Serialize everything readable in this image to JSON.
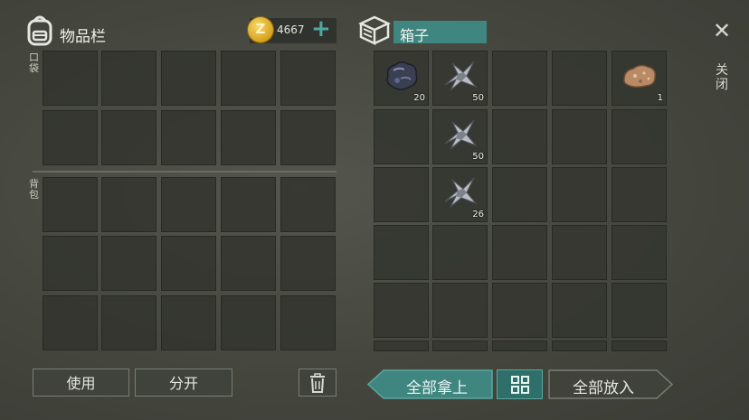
{
  "inventory": {
    "title": "物品栏",
    "icon": "backpack-icon"
  },
  "currency": {
    "amount": "4667",
    "coin_icon": "coin-icon",
    "coin_symbol": "Z",
    "add_symbol": "+"
  },
  "pockets": {
    "label": "口袋"
  },
  "backpack": {
    "label": "背包"
  },
  "container": {
    "title": "箱子",
    "icon": "box-icon"
  },
  "close": {
    "symbol": "✕",
    "label": "关闭"
  },
  "container_items": [
    {
      "name": "coal-ore",
      "count": "20"
    },
    {
      "name": "metal-shard",
      "count": "50"
    },
    {
      "name": "copper-ore",
      "count": "1"
    },
    {
      "name": "metal-shard",
      "count": "50"
    },
    {
      "name": "metal-shard",
      "count": "26"
    }
  ],
  "buttons": {
    "use": "使用",
    "split": "分开",
    "trash_icon": "trash-icon",
    "take_all": "全部拿上",
    "grid_icon": "grid-icon",
    "put_all": "全部放入"
  },
  "colors": {
    "accent": "#3f8680",
    "accent_light": "#5aa7a0"
  }
}
